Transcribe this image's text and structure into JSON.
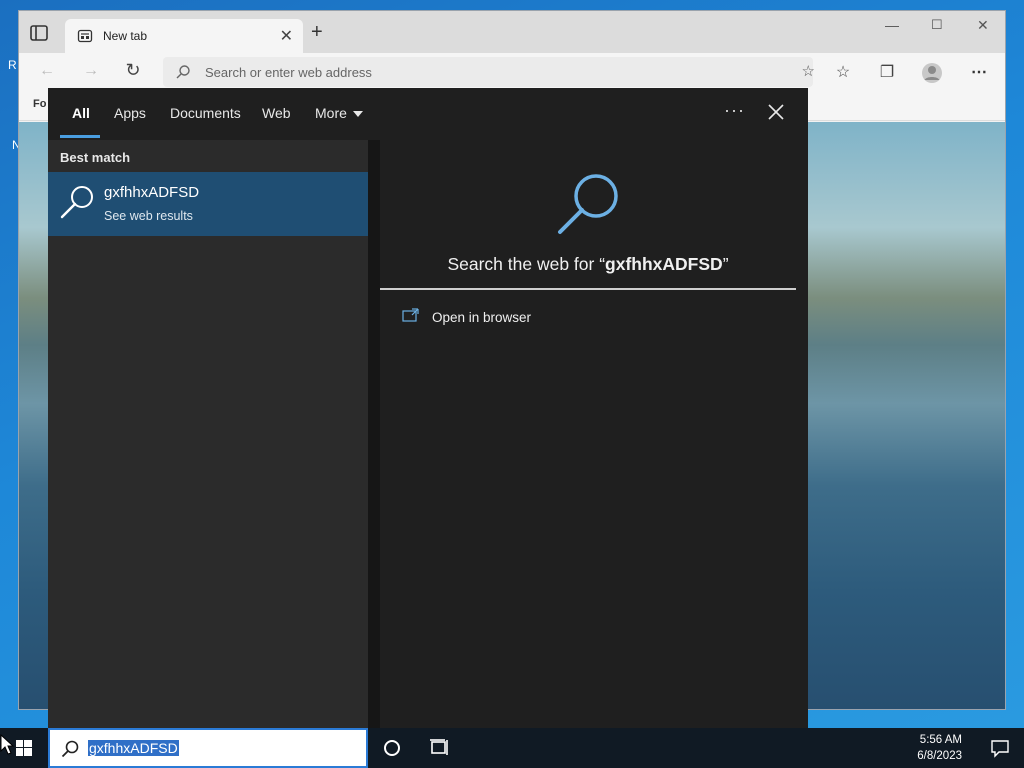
{
  "desktop": {
    "peek1": "R",
    "peek2": "N"
  },
  "browser": {
    "tab_title": "New tab",
    "address_placeholder": "Search or enter web address",
    "favorites_bar_label": "Fo"
  },
  "flyout": {
    "tabs": [
      {
        "label": "All"
      },
      {
        "label": "Apps"
      },
      {
        "label": "Documents"
      },
      {
        "label": "Web"
      },
      {
        "label": "More"
      }
    ],
    "best_match_heading": "Best match",
    "best_match": {
      "title": "gxfhhxADFSD",
      "subtitle": "See web results"
    },
    "search_web_prefix": "Search the web for “",
    "search_web_query": "gxfhhxADFSD",
    "search_web_suffix": "”",
    "open_in_browser": "Open in browser",
    "accent_color": "#4a9ee0",
    "selection_color": "#1f4e73"
  },
  "taskbar": {
    "search_text": "gxfhhxADFSD",
    "time": "5:56 AM",
    "date": "6/8/2023"
  }
}
